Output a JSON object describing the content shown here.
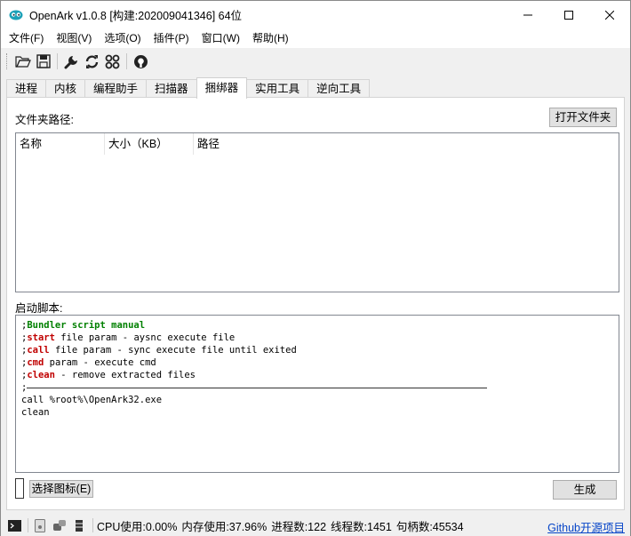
{
  "window": {
    "title": "OpenArk v1.0.8  [构建:202009041346]  64位"
  },
  "menu": [
    "文件(F)",
    "视图(V)",
    "选项(O)",
    "插件(P)",
    "窗口(W)",
    "帮助(H)"
  ],
  "toolbar": {
    "icons": [
      "open-folder-icon",
      "save-icon",
      "wrench-icon",
      "refresh-icon",
      "grid-icon",
      "github-icon"
    ]
  },
  "tabs": [
    {
      "label": "进程",
      "active": false
    },
    {
      "label": "内核",
      "active": false
    },
    {
      "label": "编程助手",
      "active": false
    },
    {
      "label": "扫描器",
      "active": false
    },
    {
      "label": "捆绑器",
      "active": true
    },
    {
      "label": "实用工具",
      "active": false
    },
    {
      "label": "逆向工具",
      "active": false
    }
  ],
  "bundler": {
    "folder_label": "文件夹路径:",
    "open_folder_button": "打开文件夹",
    "columns": [
      "名称",
      "大小（KB）",
      "路径"
    ],
    "script_label": "启动脚本:",
    "script_lines": [
      [
        {
          "t": ";"
        },
        {
          "t": "Bundler script manual",
          "s": "kwg"
        }
      ],
      [
        {
          "t": ";"
        },
        {
          "t": "start",
          "s": "kw"
        },
        {
          "t": " file param - aysnc execute file"
        }
      ],
      [
        {
          "t": ";"
        },
        {
          "t": "call",
          "s": "kw"
        },
        {
          "t": " file param - sync execute file until exited"
        }
      ],
      [
        {
          "t": ";"
        },
        {
          "t": "cmd",
          "s": "kw"
        },
        {
          "t": " param - execute cmd"
        }
      ],
      [
        {
          "t": ";"
        },
        {
          "t": "clean",
          "s": "kw"
        },
        {
          "t": " - remove extracted files"
        }
      ],
      [
        {
          "t": ";"
        },
        {
          "t": "",
          "s": "line"
        }
      ],
      [
        {
          "t": "call %root%\\OpenArk32.exe"
        }
      ],
      [
        {
          "t": "clean"
        }
      ]
    ],
    "select_icon_button": "选择图标(E)",
    "generate_button": "生成"
  },
  "statusbar": {
    "cpu": "CPU使用:0.00%",
    "memory": "内存使用:37.96%",
    "processes": "进程数:122",
    "threads": "线程数:1451",
    "handles": "句柄数:45534",
    "link": "Github开源项目"
  },
  "colors": {
    "keyword": "#c00000",
    "keyword_title": "#008000",
    "link": "#0645c8"
  }
}
